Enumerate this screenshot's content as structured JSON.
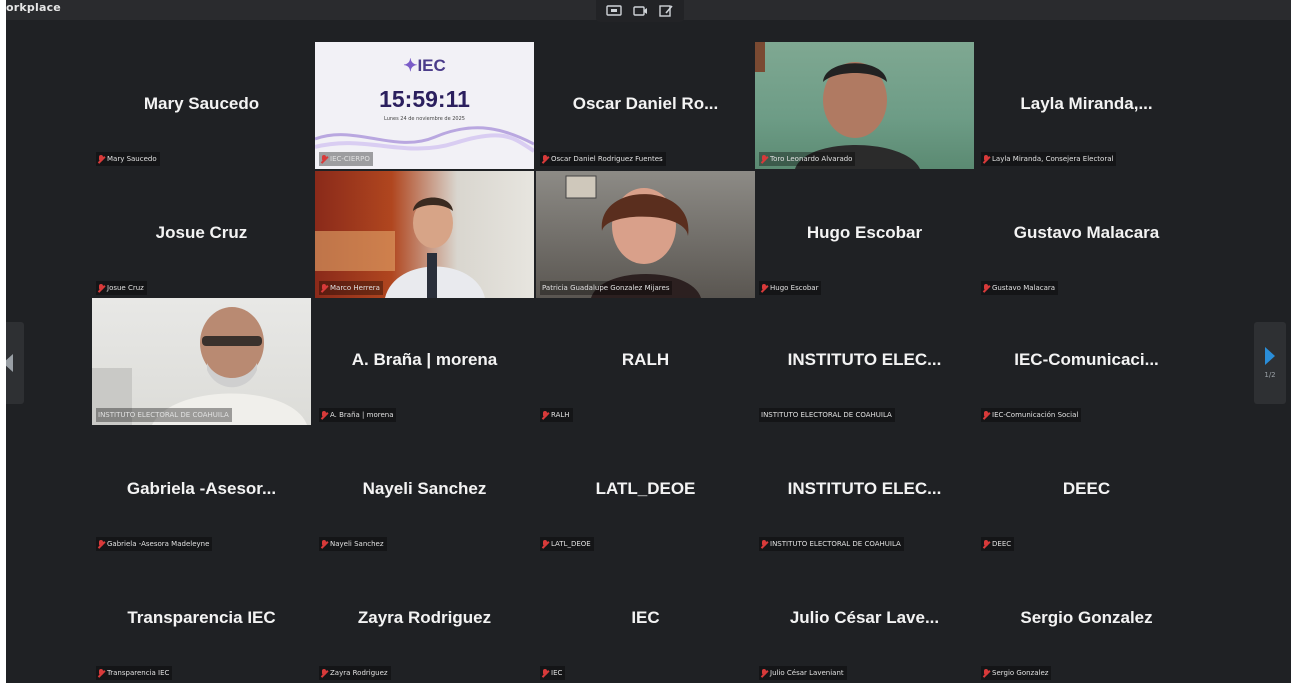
{
  "window": {
    "title": "orkplace"
  },
  "toolbar": {
    "icons": [
      "screen-share-icon",
      "camera-switch-icon",
      "edit-icon"
    ]
  },
  "colors": {
    "background": "#1f2124",
    "active_speaker": "#2ecc71",
    "muted": "#d83a3a",
    "next_arrow": "#2a8dd8"
  },
  "slide": {
    "logo": "IEC",
    "clock": "15:59:11",
    "date": "Lunes 24 de noviembre de 2025"
  },
  "tiles": [
    {
      "name": "Mary Saucedo",
      "label": "Mary Saucedo",
      "muted": true
    },
    {
      "name": "",
      "label": "IEC-CIERPO",
      "muted": true
    },
    {
      "name": "Oscar Daniel Ro...",
      "label": "Oscar Daniel Rodriguez Fuentes",
      "muted": true
    },
    {
      "name": "",
      "label": "Toro Leonardo Alvarado",
      "muted": true
    },
    {
      "name": "Layla Miranda,...",
      "label": "Layla Miranda, Consejera Electoral",
      "muted": true
    },
    {
      "name": "Josue Cruz",
      "label": "Josue Cruz",
      "muted": true
    },
    {
      "name": "",
      "label": "Marco Herrera",
      "muted": true
    },
    {
      "name": "",
      "label": "Patricia Guadalupe Gonzalez Mijares",
      "muted": false,
      "active": true
    },
    {
      "name": "Hugo Escobar",
      "label": "Hugo Escobar",
      "muted": true
    },
    {
      "name": "Gustavo Malacara",
      "label": "Gustavo Malacara",
      "muted": true
    },
    {
      "name": "",
      "label": "INSTITUTO ELECTORAL DE COAHUILA",
      "muted": false
    },
    {
      "name": "A. Braña | morena",
      "label": "A. Braña | morena",
      "muted": true
    },
    {
      "name": "RALH",
      "label": "RALH",
      "muted": true
    },
    {
      "name": "INSTITUTO ELEC...",
      "label": "INSTITUTO ELECTORAL DE COAHUILA",
      "muted": false
    },
    {
      "name": "IEC-Comunicaci...",
      "label": "IEC-Comunicación Social",
      "muted": true
    },
    {
      "name": "Gabriela -Asesor...",
      "label": "Gabriela -Asesora Madeleyne",
      "muted": true
    },
    {
      "name": "Nayeli Sanchez",
      "label": "Nayeli Sanchez",
      "muted": true
    },
    {
      "name": "LATL_DEOE",
      "label": "LATL_DEOE",
      "muted": true
    },
    {
      "name": "INSTITUTO ELEC...",
      "label": "INSTITUTO ELECTORAL DE COAHUILA",
      "muted": true
    },
    {
      "name": "DEEC",
      "label": "DEEC",
      "muted": true
    },
    {
      "name": "Transparencia IEC",
      "label": "Transparencia IEC",
      "muted": true
    },
    {
      "name": "Zayra Rodriguez",
      "label": "Zayra Rodriguez",
      "muted": true
    },
    {
      "name": "IEC",
      "label": "IEC",
      "muted": true
    },
    {
      "name": "Julio César Lave...",
      "label": "Julio César Laveniant",
      "muted": true
    },
    {
      "name": "Sergio Gonzalez",
      "label": "Sergio Gonzalez",
      "muted": true
    }
  ],
  "nav": {
    "prev_page": "",
    "next_page": "1/2"
  }
}
